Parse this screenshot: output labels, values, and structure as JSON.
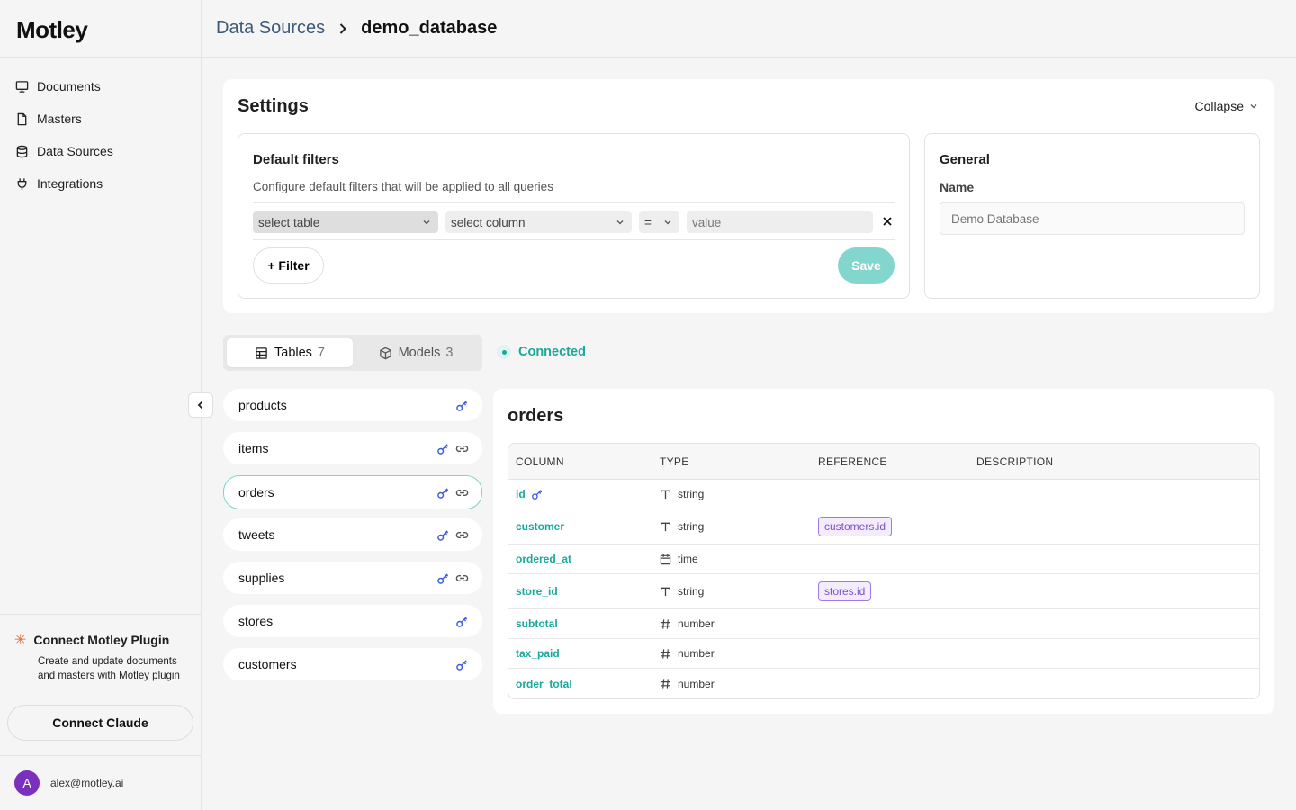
{
  "app": {
    "logo_text": "Motley"
  },
  "sidebar": {
    "items": [
      {
        "label": "Documents",
        "icon": "monitor-icon"
      },
      {
        "label": "Masters",
        "icon": "file-icon"
      },
      {
        "label": "Data Sources",
        "icon": "database-icon"
      },
      {
        "label": "Integrations",
        "icon": "plug-icon"
      }
    ],
    "plugin": {
      "title": "Connect Motley Plugin",
      "description": "Create and update documents and masters with Motley plugin",
      "button_label": "Connect Claude"
    },
    "user": {
      "avatar_letter": "A",
      "email": "alex@motley.ai",
      "avatar_color": "#7a2fbd"
    }
  },
  "breadcrumb": {
    "parent": "Data Sources",
    "current": "demo_database"
  },
  "settings": {
    "title": "Settings",
    "collapse_label": "Collapse",
    "filters": {
      "title": "Default filters",
      "description": "Configure default filters that will be applied to all queries",
      "table_placeholder": "select table",
      "column_placeholder": "select column",
      "operator": "=",
      "value_placeholder": "value",
      "add_label": "+ Filter",
      "save_label": "Save"
    },
    "general": {
      "title": "General",
      "name_label": "Name",
      "name_placeholder": "Demo Database"
    }
  },
  "tabs": [
    {
      "label": "Tables",
      "count": "7"
    },
    {
      "label": "Models",
      "count": "3"
    }
  ],
  "connection_status": "Connected",
  "tables": [
    {
      "name": "products",
      "key": true,
      "link": false
    },
    {
      "name": "items",
      "key": true,
      "link": true
    },
    {
      "name": "orders",
      "key": true,
      "link": true,
      "active": true
    },
    {
      "name": "tweets",
      "key": true,
      "link": true
    },
    {
      "name": "supplies",
      "key": true,
      "link": true
    },
    {
      "name": "stores",
      "key": true,
      "link": false
    },
    {
      "name": "customers",
      "key": true,
      "link": false
    }
  ],
  "detail": {
    "title": "orders",
    "headers": {
      "column": "COLUMN",
      "type": "TYPE",
      "reference": "REFERENCE",
      "description": "DESCRIPTION"
    },
    "rows": [
      {
        "column": "id",
        "primary_key": true,
        "type": "string",
        "type_icon": "text-type-icon",
        "reference": ""
      },
      {
        "column": "customer",
        "type": "string",
        "type_icon": "text-type-icon",
        "reference": "customers.id"
      },
      {
        "column": "ordered_at",
        "type": "time",
        "type_icon": "calendar-icon",
        "reference": ""
      },
      {
        "column": "store_id",
        "type": "string",
        "type_icon": "text-type-icon",
        "reference": "stores.id"
      },
      {
        "column": "subtotal",
        "type": "number",
        "type_icon": "hash-icon",
        "reference": ""
      },
      {
        "column": "tax_paid",
        "type": "number",
        "type_icon": "hash-icon",
        "reference": ""
      },
      {
        "column": "order_total",
        "type": "number",
        "type_icon": "hash-icon",
        "reference": ""
      }
    ]
  },
  "colors": {
    "accent": "#1aa89b",
    "save_button": "#83d6cd",
    "reference_badge": "#7c4dcb",
    "key_icon": "#3a5bd9"
  }
}
